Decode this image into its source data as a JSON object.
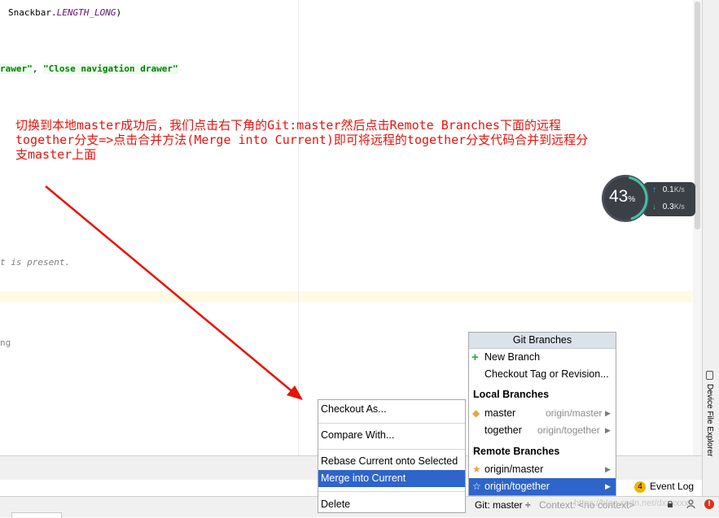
{
  "editor": {
    "line1_prefix": "Snackbar.",
    "line1_italic": "LENGTH_LONG",
    "line1_suffix": ")",
    "line2_str1": "rawer\"",
    "line2_sep": ", ",
    "line2_str2": "\"Close navigation drawer\"",
    "line3_gray": "t is present.",
    "line4_text": "ng"
  },
  "annotation": {
    "line1": "切换到本地master成功后，我们点击右下角的Git:master然后点击Remote Branches下面的远程",
    "line2": "together分支=>点击合并方法(Merge into Current)即可将远程的together分支代码合并到远程分",
    "line3": "支master上面"
  },
  "net_widget": {
    "percent": "43",
    "percent_symbol": "%",
    "upload": "0.1",
    "download": "0.3",
    "unit": "K/s",
    "ring_color": "#3ec4a3"
  },
  "git_branches_popup": {
    "title": "Git Branches",
    "new_branch": "New Branch",
    "checkout_tag": "Checkout Tag or Revision...",
    "local_header": "Local Branches",
    "local": [
      {
        "name": "master",
        "tracking": "origin/master"
      },
      {
        "name": "together",
        "tracking": "origin/together"
      }
    ],
    "remote_header": "Remote Branches",
    "remote": [
      {
        "name": "origin/master"
      },
      {
        "name": "origin/together"
      }
    ]
  },
  "context_menu": {
    "checkout_as": "Checkout As...",
    "compare_with": "Compare With...",
    "rebase": "Rebase Current onto Selected",
    "merge": "Merge into Current",
    "delete": "Delete"
  },
  "status": {
    "git": "Git: master ÷",
    "context": "Context: <no context>",
    "event_log_count": "4",
    "event_log": "Event Log",
    "watermark": "https://blog.csdn.net/dxxxxxxx"
  },
  "side_panel": {
    "device_file_explorer": "Device File Explorer"
  },
  "colors": {
    "annotation": "#e8120c",
    "selection": "#2f65ca",
    "popup_title_bg": "#dbe2ea"
  }
}
